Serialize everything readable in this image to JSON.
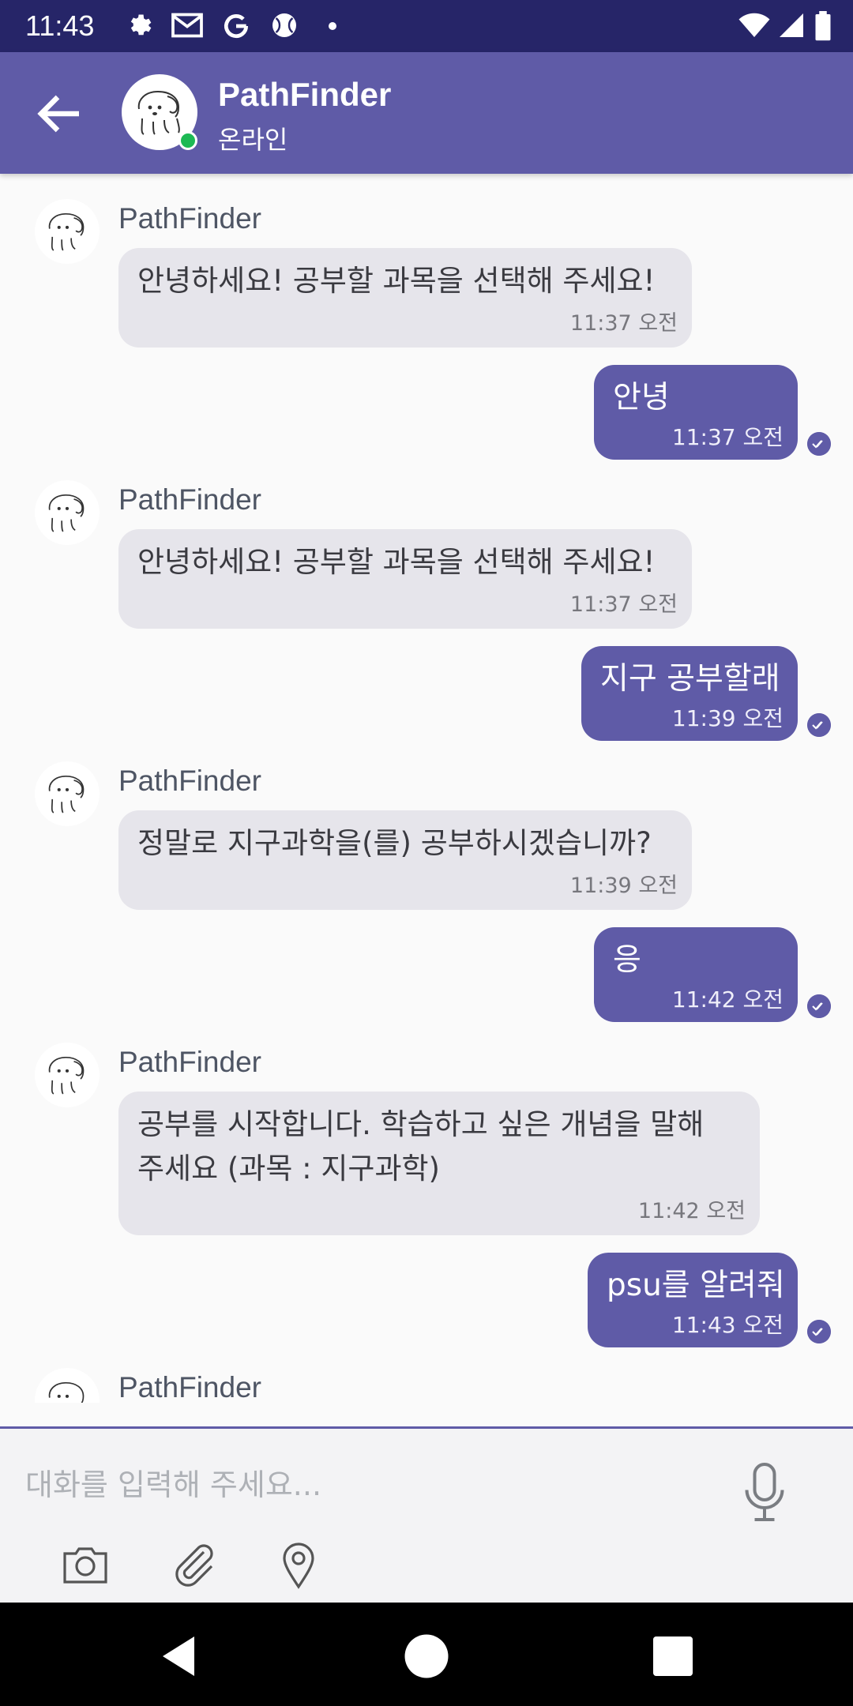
{
  "status_bar": {
    "time": "11:43"
  },
  "header": {
    "title": "PathFinder",
    "status": "온라인"
  },
  "messages": [
    {
      "sender": "PathFinder",
      "text": "안녕하세요! 공부할 과목을 선택해 주세요!",
      "time": "11:37 오전"
    },
    {
      "text": "안녕",
      "time": "11:37 오전"
    },
    {
      "sender": "PathFinder",
      "text": "안녕하세요! 공부할 과목을 선택해 주세요!",
      "time": "11:37 오전"
    },
    {
      "text": "지구 공부할래",
      "time": "11:39 오전"
    },
    {
      "sender": "PathFinder",
      "text": "정말로 지구과학을(를) 공부하시겠습니까?",
      "time": "11:39 오전"
    },
    {
      "text": "응",
      "time": "11:42 오전"
    },
    {
      "sender": "PathFinder",
      "text": "공부를 시작합니다. 학습하고 싶은 개념을 말해\n주세요 (과목 : 지구과학)",
      "time": "11:42 오전"
    },
    {
      "text": "psu를 알려줘",
      "time": "11:43 오전"
    },
    {
      "sender": "PathFinder"
    }
  ],
  "input": {
    "placeholder": "대화를 입력해 주세요..."
  },
  "colors": {
    "primary": "#5F5BA7",
    "status_bar": "#262568",
    "incoming_bubble": "#E6E5EB",
    "online": "#1DB954"
  },
  "icons": [
    "settings-icon",
    "gmail-icon",
    "google-icon",
    "sports-icon",
    "wifi-icon",
    "signal-icon",
    "battery-icon",
    "back-arrow-icon",
    "microphone-icon",
    "camera-icon",
    "attachment-icon",
    "location-icon"
  ]
}
